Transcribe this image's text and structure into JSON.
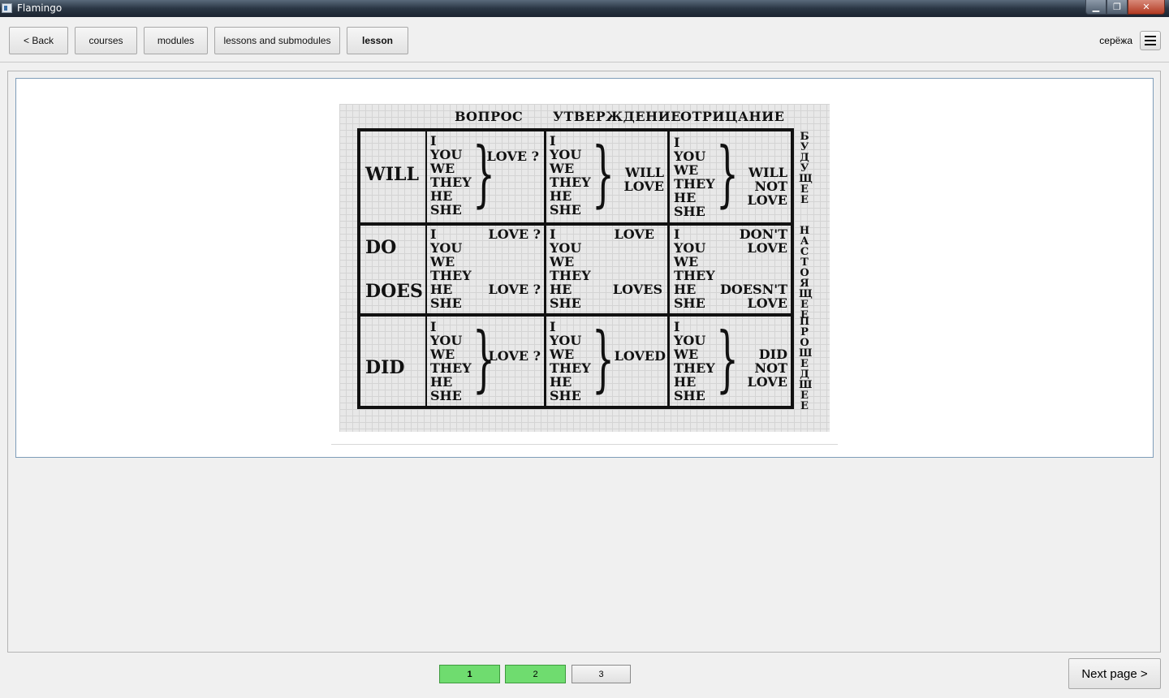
{
  "window": {
    "title": "Flamingo",
    "controls": {
      "minimize": "▁",
      "maximize": "❐",
      "close": "✕"
    }
  },
  "nav": {
    "back": "< Back",
    "courses": "courses",
    "modules": "modules",
    "lessons": "lessons and submodules",
    "lesson": "lesson",
    "active_tab": "lesson"
  },
  "user": {
    "name": "серёжа",
    "menu_icon": "hamburger-menu-icon"
  },
  "lesson_image": {
    "headers": [
      "ВОПРОС",
      "УТВЕРЖДЕНИЕ",
      "ОТРИЦАНИЕ"
    ],
    "rows": [
      {
        "aux": "WILL",
        "pronouns": "I\nYOU\nWE\nTHEY\nHE\nSHE",
        "question": "LOVE ?",
        "affirmative_pronouns": "I\nYOU\nWE\nTHEY\nHE\nSHE",
        "affirmative": "WILL\nLOVE",
        "negative_pronouns": "I\nYOU\nWE\nTHEY\nHE\nSHE",
        "negative": "WILL\nNOT\nLOVE",
        "side": "БУДУЩЕЕ"
      },
      {
        "aux": "DO",
        "aux2": "DOES",
        "pronouns": "I\nYOU\nWE\nTHEY\nHE\nSHE",
        "question": "LOVE ?",
        "question2": "LOVE ?",
        "affirmative_pronouns": "I\nYOU\nWE\nTHEY\nHE\nSHE",
        "affirmative": "LOVE",
        "affirmative2": "LOVES",
        "negative_pronouns": "I\nYOU\nWE\nTHEY\nHE\nSHE",
        "negative": "DON'T\nLOVE",
        "negative2": "DOESN'T\nLOVE",
        "side": "НАСТОЯЩЕЕ"
      },
      {
        "aux": "DID",
        "pronouns": "I\nYOU\nWE\nTHEY\nHE\nSHE",
        "question": "LOVE ?",
        "affirmative_pronouns": "I\nYOU\nWE\nTHEY\nHE\nSHE",
        "affirmative": "LOVED",
        "negative_pronouns": "I\nYOU\nWE\nTHEY\nHE\nSHE",
        "negative": "DID\nNOT\nLOVE",
        "side": "ПРОШЕДШЕЕ"
      }
    ]
  },
  "pagination": {
    "pages": [
      {
        "label": "1",
        "status": "done",
        "current": true
      },
      {
        "label": "2",
        "status": "done",
        "current": false
      },
      {
        "label": "3",
        "status": "todo",
        "current": false
      }
    ],
    "next": "Next page >"
  },
  "colors": {
    "page_done": "#6fdc6f",
    "panel_border": "#7f9db9"
  }
}
